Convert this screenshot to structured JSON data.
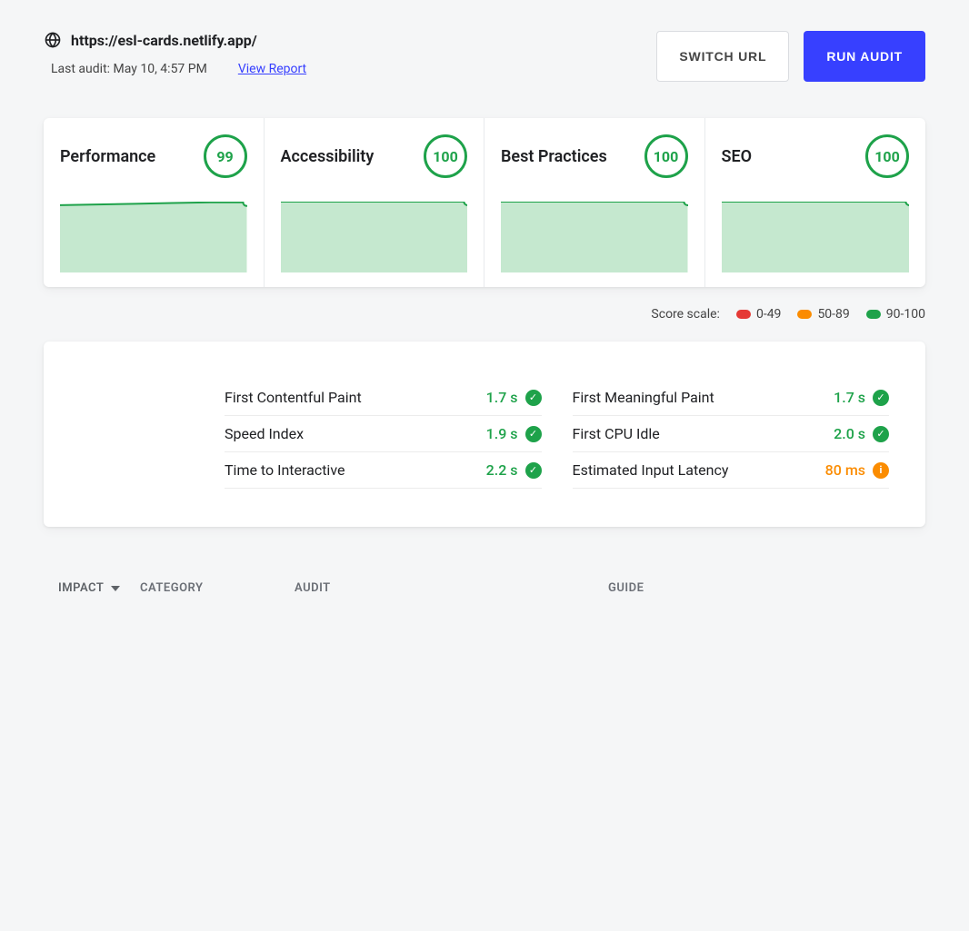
{
  "header": {
    "url": "https://esl-cards.netlify.app/",
    "last_audit": "Last audit: May 10, 4:57 PM",
    "view_report": "View Report",
    "switch_url_label": "SWITCH URL",
    "run_audit_label": "RUN AUDIT"
  },
  "cards": [
    {
      "title": "Performance",
      "score": "99"
    },
    {
      "title": "Accessibility",
      "score": "100"
    },
    {
      "title": "Best Practices",
      "score": "100"
    },
    {
      "title": "SEO",
      "score": "100"
    }
  ],
  "score_scale": {
    "label": "Score scale:",
    "low": "0-49",
    "mid": "50-89",
    "high": "90-100"
  },
  "metrics_left": [
    {
      "name": "First Contentful Paint",
      "value": "1.7 s",
      "status": "ok"
    },
    {
      "name": "Speed Index",
      "value": "1.9 s",
      "status": "ok"
    },
    {
      "name": "Time to Interactive",
      "value": "2.2 s",
      "status": "ok"
    }
  ],
  "metrics_right": [
    {
      "name": "First Meaningful Paint",
      "value": "1.7 s",
      "status": "ok"
    },
    {
      "name": "First CPU Idle",
      "value": "2.0 s",
      "status": "ok"
    },
    {
      "name": "Estimated Input Latency",
      "value": "80 ms",
      "status": "warn"
    }
  ],
  "table_headers": {
    "impact": "IMPACT",
    "category": "CATEGORY",
    "audit": "AUDIT",
    "guide": "GUIDE"
  },
  "colors": {
    "green": "#1ea24a",
    "orange": "#fb8c00",
    "red": "#e53935",
    "primary": "#3740ff"
  },
  "chart_data": [
    {
      "type": "area",
      "title": "Performance",
      "ylim": [
        0,
        100
      ],
      "values": [
        95,
        96,
        97,
        98,
        99,
        99
      ]
    },
    {
      "type": "area",
      "title": "Accessibility",
      "ylim": [
        0,
        100
      ],
      "values": [
        100,
        100,
        100,
        100,
        100,
        100
      ]
    },
    {
      "type": "area",
      "title": "Best Practices",
      "ylim": [
        0,
        100
      ],
      "values": [
        100,
        100,
        100,
        100,
        100,
        100
      ]
    },
    {
      "type": "area",
      "title": "SEO",
      "ylim": [
        0,
        100
      ],
      "values": [
        100,
        100,
        100,
        100,
        100,
        100
      ]
    }
  ]
}
